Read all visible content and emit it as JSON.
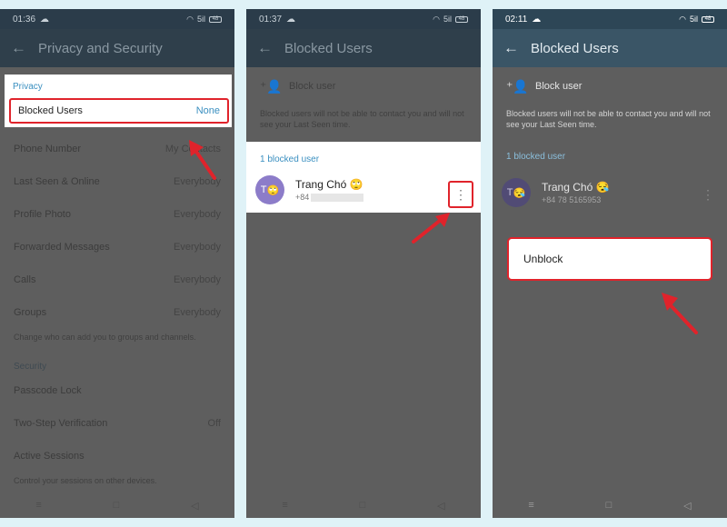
{
  "phone1": {
    "status_time": "01:36",
    "title": "Privacy and Security",
    "privacy_header": "Privacy",
    "blocked_users_label": "Blocked Users",
    "blocked_users_value": "None",
    "rows": [
      {
        "label": "Phone Number",
        "value": "My Contacts"
      },
      {
        "label": "Last Seen & Online",
        "value": "Everybody"
      },
      {
        "label": "Profile Photo",
        "value": "Everybody"
      },
      {
        "label": "Forwarded Messages",
        "value": "Everybody"
      },
      {
        "label": "Calls",
        "value": "Everybody"
      },
      {
        "label": "Groups",
        "value": "Everybody"
      }
    ],
    "groups_note": "Change who can add you to groups and channels.",
    "security_header": "Security",
    "security_rows": [
      {
        "label": "Passcode Lock",
        "value": ""
      },
      {
        "label": "Two-Step Verification",
        "value": "Off"
      },
      {
        "label": "Active Sessions",
        "value": ""
      }
    ],
    "sessions_note": "Control your sessions on other devices."
  },
  "phone2": {
    "status_time": "01:37",
    "title": "Blocked Users",
    "block_user_label": "Block user",
    "info_note": "Blocked users will not be able to contact you and will not see your Last Seen time.",
    "count_label": "1 blocked user",
    "user_initial": "T",
    "user_name": "Trang Chó",
    "user_phone": "+84"
  },
  "phone3": {
    "status_time": "02:11",
    "title": "Blocked Users",
    "block_user_label": "Block user",
    "info_note": "Blocked users will not be able to contact you and will not see your Last Seen time.",
    "count_label": "1 blocked user",
    "user_initial": "T",
    "user_name": "Trang Chó",
    "user_phone": "+84 78 5165953",
    "menu_unblock": "Unblock"
  },
  "status": {
    "signal": "5il",
    "battery": "48"
  },
  "icons": {
    "back": "arrow-left-icon",
    "block_user": "person-add-icon",
    "menu": "more-vert-icon",
    "emoji": "face-emoji-icon"
  },
  "colors": {
    "highlight": "#e0232b",
    "accent": "#3a8fc0",
    "avatar": "#8c7cc9",
    "appbar": "#2f3f4b"
  }
}
